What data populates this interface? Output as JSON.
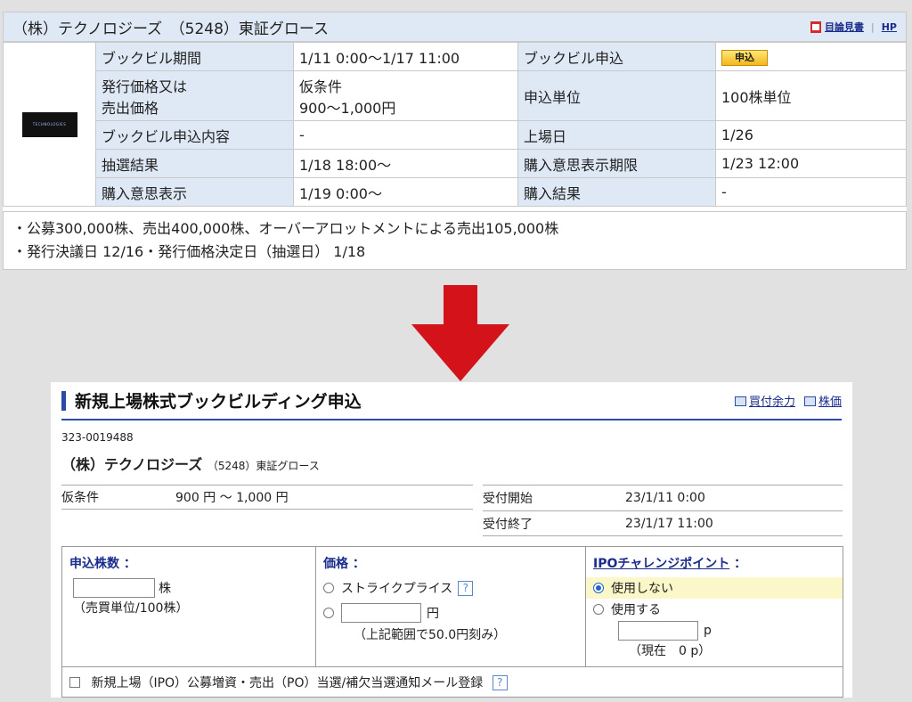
{
  "top": {
    "company": "（株）テクノロジーズ　（5248）東証グロース",
    "links": {
      "prospectus": "目論見書",
      "hp": "HP"
    },
    "logo_text": "TECHNOLOGIES",
    "rows": [
      {
        "l1": "ブックビル期間",
        "v1": "1/11 0:00〜1/17 11:00",
        "l2": "ブックビル申込",
        "v2_button": "申込"
      },
      {
        "l1a": "発行価格又は",
        "l1b": "売出価格",
        "v1a": "仮条件",
        "v1b": "900〜1,000円",
        "l2": "申込単位",
        "v2": "100株単位"
      },
      {
        "l1": "ブックビル申込内容",
        "v1": "-",
        "l2": "上場日",
        "v2": "1/26"
      },
      {
        "l1": "抽選結果",
        "v1": "1/18 18:00〜",
        "l2": "購入意思表示期限",
        "v2": "1/23 12:00"
      },
      {
        "l1": "購入意思表示",
        "v1": "1/19 0:00〜",
        "l2": "購入結果",
        "v2": "-"
      }
    ],
    "notes": [
      "・公募300,000株、売出400,000株、オーバーアロットメントによる売出105,000株",
      "・発行決議日 12/16・発行価格決定日（抽選日） 1/18"
    ]
  },
  "colors": {
    "arrow": "#d4121a",
    "header_bg": "#dfe9f5",
    "accent": "#2c4ca3",
    "link": "#1a2c8c"
  },
  "bottom": {
    "title": "新規上場株式ブックビルディング申込",
    "links": {
      "buying_power": "買付余力",
      "stock_price": "株価"
    },
    "account": "323-0019488",
    "company": "（株）テクノロジーズ",
    "company_sub": "（5248）東証グロース",
    "tentative_label": "仮条件",
    "tentative_value": "900 円 〜 1,000 円",
    "start_label": "受付開始",
    "start_value": "23/1/11 0:00",
    "end_label": "受付終了",
    "end_value": "23/1/17 11:00",
    "form": {
      "qty_title": "申込株数 ：",
      "qty_unit": "株",
      "qty_note": "（売買単位/100株）",
      "price_title": "価格 ：",
      "strike": "ストライクプライス",
      "yen": "円",
      "price_note": "（上記範囲で50.0円刻み）",
      "ipo_title": "IPOチャレンジポイント",
      "ipo_colon": "：",
      "no_use": "使用しない",
      "use": "使用する",
      "p_unit": "p",
      "current": "（現在　0 p）",
      "mail": "新規上場（IPO）公募増資・売出（PO）当選/補欠当選通知メール登録",
      "help": "?"
    }
  }
}
